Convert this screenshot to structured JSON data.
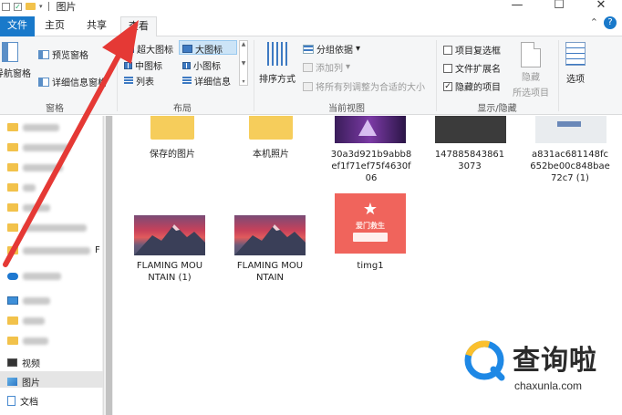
{
  "window": {
    "title": "图片",
    "controls": [
      "—",
      "☐",
      "✕"
    ]
  },
  "tabs": [
    {
      "label": "文件"
    },
    {
      "label": "主页"
    },
    {
      "label": "共享"
    },
    {
      "label": "查看"
    }
  ],
  "ribbon": {
    "expand_glyph": "⌃",
    "help": "?",
    "pane_group": {
      "label": "窗格",
      "nav_pane": "导航窗格",
      "preview_pane": "预览窗格",
      "details_pane": "详细信息窗格"
    },
    "layout_group": {
      "label": "布局",
      "options": [
        "超大图标",
        "大图标",
        "中图标",
        "小图标",
        "列表",
        "详细信息"
      ],
      "selected": "大图标"
    },
    "view_group": {
      "label": "当前视图",
      "sort": "排序方式",
      "group_by": "分组依据",
      "add_column": "添加列",
      "fit_columns": "将所有列调整为合适的大小"
    },
    "showhide_group": {
      "label": "显示/隐藏",
      "item_checkboxes": "项目复选框",
      "file_extensions": "文件扩展名",
      "hidden_items": "隐藏的项目",
      "hide_selected_line1": "隐藏",
      "hide_selected_line2": "所选项目"
    },
    "options": "选项"
  },
  "nav": {
    "items": [
      {
        "label": "视频",
        "icon": "video-icon"
      },
      {
        "label": "图片",
        "icon": "pictures-icon",
        "selected": true
      },
      {
        "label": "文档",
        "icon": "documents-icon"
      }
    ],
    "trailing_char": "F"
  },
  "files": [
    {
      "name": "保存的图片",
      "type": "folder"
    },
    {
      "name": "本机照片",
      "type": "folder"
    },
    {
      "name": "30a3d921b9abb8ef1f71ef75f4630f06",
      "type": "image"
    },
    {
      "name": "1478858438613073",
      "type": "image"
    },
    {
      "name": "a831ac681148fc652be00c848bae72c7 (1)",
      "type": "image"
    },
    {
      "name": "FLAMING MOUNTAIN (1)",
      "type": "image"
    },
    {
      "name": "FLAMING MOUNTAIN",
      "type": "image"
    },
    {
      "name": "timg1",
      "type": "image"
    }
  ],
  "thumb_text": {
    "timg1_title": "爱门救生"
  },
  "watermark": {
    "brand": "查询啦",
    "url": "chaxunla.com"
  },
  "colors": {
    "accent": "#1979ca",
    "arrow": "#e53935",
    "folder": "#f6cd5b"
  }
}
